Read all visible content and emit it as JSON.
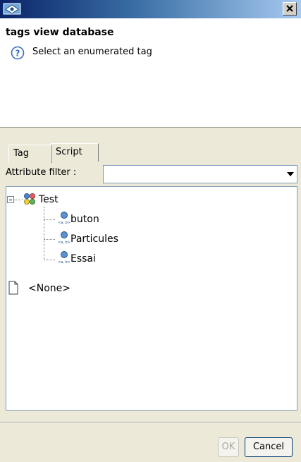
{
  "window": {
    "title": ""
  },
  "dialog": {
    "title": "tags view database",
    "message": "Select an enumerated tag"
  },
  "tabs": [
    {
      "label": "Tag",
      "selected": true
    },
    {
      "label": "Script",
      "selected": false
    }
  ],
  "filter": {
    "label": "Attribute filter :",
    "value": ""
  },
  "tree": {
    "root": {
      "label": "Test",
      "expanded": true
    },
    "children": [
      {
        "label": "buton"
      },
      {
        "label": "Particules"
      },
      {
        "label": "Essai"
      }
    ],
    "other": {
      "label": "<None>"
    }
  },
  "buttons": {
    "ok": "OK",
    "cancel": "Cancel"
  },
  "icon_badge": "<a, b>"
}
